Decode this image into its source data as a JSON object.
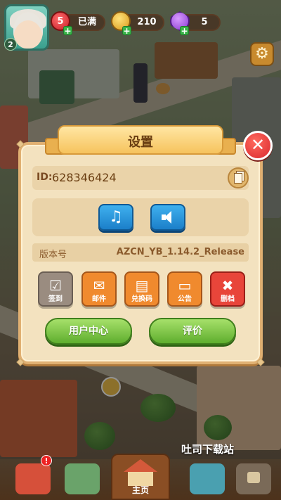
{
  "hud": {
    "level": "2",
    "hearts_count": "5",
    "hearts_status": "已满",
    "coins": "210",
    "gems": "5"
  },
  "dialog": {
    "title": "设置",
    "id_label": "ID:",
    "id_value": "628346424",
    "music_icon": "♫",
    "sound_icon": "🔈",
    "version_label": "版本号",
    "version_value": "AZCN_YB_1.14.2_Release",
    "actions": [
      {
        "label": "签到",
        "icon": "checkin-icon",
        "color": "#9a8c80"
      },
      {
        "label": "邮件",
        "icon": "mail-icon",
        "color": "#f08a2e"
      },
      {
        "label": "兑换码",
        "icon": "ticket-icon",
        "color": "#f08a2e"
      },
      {
        "label": "公告",
        "icon": "notice-icon",
        "color": "#f08a2e"
      },
      {
        "label": "删档",
        "icon": "delete-icon",
        "color": "#e8453a"
      }
    ],
    "user_center": "用户中心",
    "rate": "评价"
  },
  "bottom_nav": {
    "home_label": "主页"
  },
  "watermark": "吐司下载站",
  "colors": {
    "accent_green": "#5fae2e",
    "accent_blue": "#1b7fc9",
    "close_red": "#d9282e",
    "panel_bg": "#f3e2bf"
  }
}
